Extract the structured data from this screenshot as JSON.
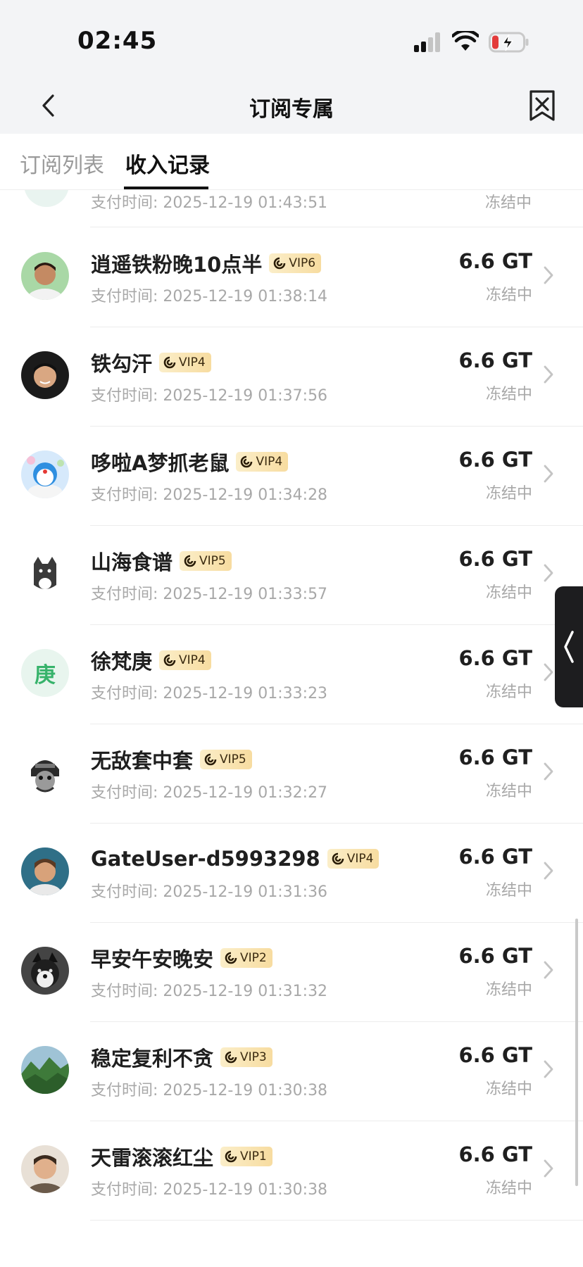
{
  "status_bar": {
    "time": "02:45"
  },
  "nav": {
    "title": "订阅专属"
  },
  "tabs": [
    {
      "label": "订阅列表"
    },
    {
      "label": "收入记录"
    }
  ],
  "partial_row": {
    "pay_time": "支付时间: 2025-12-19 01:43:51",
    "status": "冻结中"
  },
  "records": [
    {
      "name": "逍遥铁粉晚10点半",
      "vip": "VIP6",
      "pay_time": "支付时间: 2025-12-19 01:38:14",
      "amount": "6.6 GT",
      "status": "冻结中"
    },
    {
      "name": "铁勾汗",
      "vip": "VIP4",
      "pay_time": "支付时间: 2025-12-19 01:37:56",
      "amount": "6.6 GT",
      "status": "冻结中"
    },
    {
      "name": "哆啦A梦抓老鼠",
      "vip": "VIP4",
      "pay_time": "支付时间: 2025-12-19 01:34:28",
      "amount": "6.6 GT",
      "status": "冻结中"
    },
    {
      "name": "山海食谱",
      "vip": "VIP5",
      "pay_time": "支付时间: 2025-12-19 01:33:57",
      "amount": "6.6 GT",
      "status": "冻结中"
    },
    {
      "name": "徐梵庚",
      "vip": "VIP4",
      "pay_time": "支付时间: 2025-12-19 01:33:23",
      "amount": "6.6 GT",
      "status": "冻结中",
      "avatar_text": "庚"
    },
    {
      "name": "无敌套中套",
      "vip": "VIP5",
      "pay_time": "支付时间: 2025-12-19 01:32:27",
      "amount": "6.6 GT",
      "status": "冻结中"
    },
    {
      "name": "GateUser-d5993298",
      "vip": "VIP4",
      "pay_time": "支付时间: 2025-12-19 01:31:36",
      "amount": "6.6 GT",
      "status": "冻结中"
    },
    {
      "name": "早安午安晚安",
      "vip": "VIP2",
      "pay_time": "支付时间: 2025-12-19 01:31:32",
      "amount": "6.6 GT",
      "status": "冻结中"
    },
    {
      "name": "稳定复利不贪",
      "vip": "VIP3",
      "pay_time": "支付时间: 2025-12-19 01:30:38",
      "amount": "6.6 GT",
      "status": "冻结中"
    },
    {
      "name": "天雷滚滚红尘",
      "vip": "VIP1",
      "pay_time": "支付时间: 2025-12-19 01:30:38",
      "amount": "6.6 GT",
      "status": "冻结中"
    }
  ]
}
